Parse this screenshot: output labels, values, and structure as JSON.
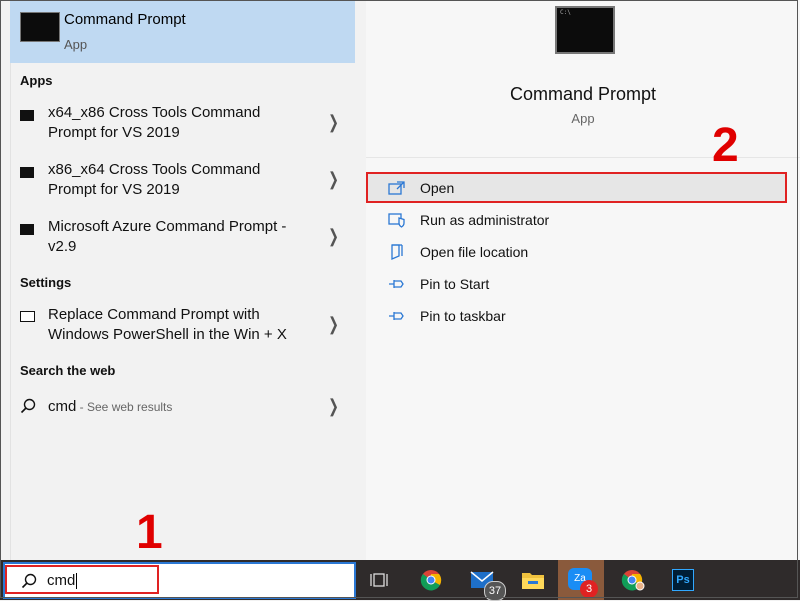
{
  "best_match": {
    "title": "Command Prompt",
    "subtitle": "App"
  },
  "sections": {
    "apps": "Apps",
    "settings": "Settings",
    "web": "Search the web"
  },
  "apps": [
    {
      "label": "x64_x86 Cross Tools Command Prompt for VS 2019"
    },
    {
      "label": "x86_x64 Cross Tools Command Prompt for VS 2019"
    },
    {
      "label": "Microsoft Azure Command Prompt - v2.9"
    }
  ],
  "settings_items": [
    {
      "label": "Replace Command Prompt with Windows PowerShell in the Win + X"
    }
  ],
  "web_result": {
    "query": "cmd",
    "suffix": " - See web results"
  },
  "preview": {
    "title": "Command Prompt",
    "subtitle": "App",
    "thumb_text": "C:\\",
    "actions": [
      {
        "label": "Open",
        "icon": "open-icon"
      },
      {
        "label": "Run as administrator",
        "icon": "shield-icon"
      },
      {
        "label": "Open file location",
        "icon": "folder-icon"
      },
      {
        "label": "Pin to Start",
        "icon": "pin-icon"
      },
      {
        "label": "Pin to taskbar",
        "icon": "pin-icon"
      }
    ]
  },
  "search_box": {
    "value": "cmd"
  },
  "step_labels": {
    "one": "1",
    "two": "2"
  },
  "taskbar": {
    "mail_badge": "37",
    "zalo_badge": "3",
    "zalo_label": "Za",
    "ps_label": "Ps",
    "icons": [
      "task-view-icon",
      "chrome-icon",
      "mail-icon",
      "file-explorer-icon",
      "zalo-icon",
      "chrome-icon",
      "photoshop-icon"
    ]
  },
  "colors": {
    "accent": "#2b78d4",
    "selection": "#bfd9f2",
    "annotation": "#e02222",
    "taskbar": "#2f2b2b"
  }
}
